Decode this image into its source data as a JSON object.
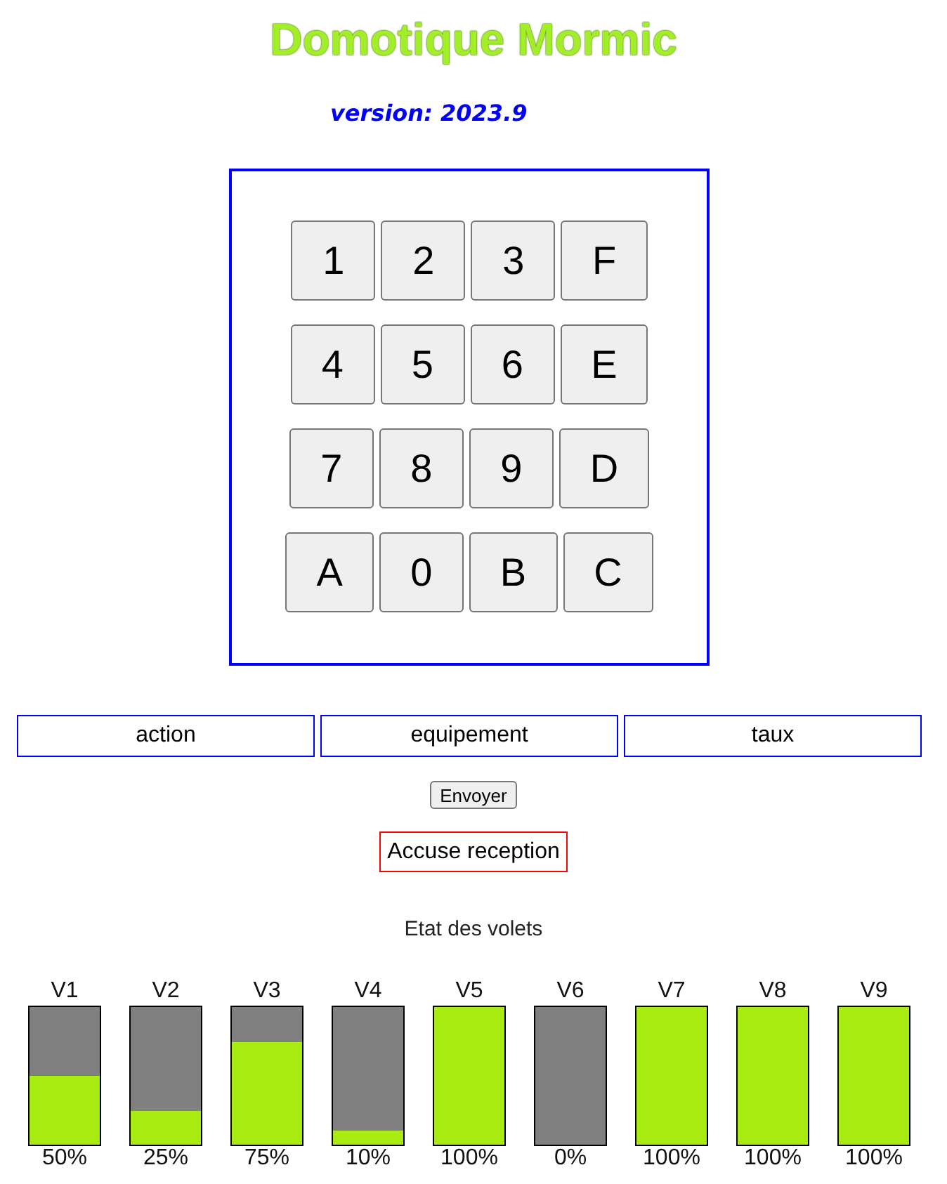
{
  "title": "Domotique Mormic",
  "version": "version: 2023.9",
  "keypad": {
    "rows": [
      [
        "1",
        "2",
        "3",
        "F"
      ],
      [
        "4",
        "5",
        "6",
        "E"
      ],
      [
        "7",
        "8",
        "9",
        "D"
      ],
      [
        "A",
        "0",
        "B",
        "C"
      ]
    ]
  },
  "fields": [
    {
      "value": "action"
    },
    {
      "value": "equipement"
    },
    {
      "value": "taux"
    }
  ],
  "send_button": "Envoyer",
  "acknowledgement": "Accuse reception",
  "shutters": {
    "title": "Etat des volets",
    "items": [
      {
        "label": "V1",
        "level": 0.5,
        "reading": "50%"
      },
      {
        "label": "V2",
        "level": 0.25,
        "reading": "25%"
      },
      {
        "label": "V3",
        "level": 0.75,
        "reading": "75%"
      },
      {
        "label": "V4",
        "level": 0.1,
        "reading": "10%"
      },
      {
        "label": "V5",
        "level": 1,
        "reading": "100%"
      },
      {
        "label": "V6",
        "level": 0,
        "reading": "0%"
      },
      {
        "label": "V7",
        "level": 1,
        "reading": "100%"
      },
      {
        "label": "V8",
        "level": 1,
        "reading": "100%"
      },
      {
        "label": "V9",
        "level": 1,
        "reading": "100%"
      }
    ]
  }
}
